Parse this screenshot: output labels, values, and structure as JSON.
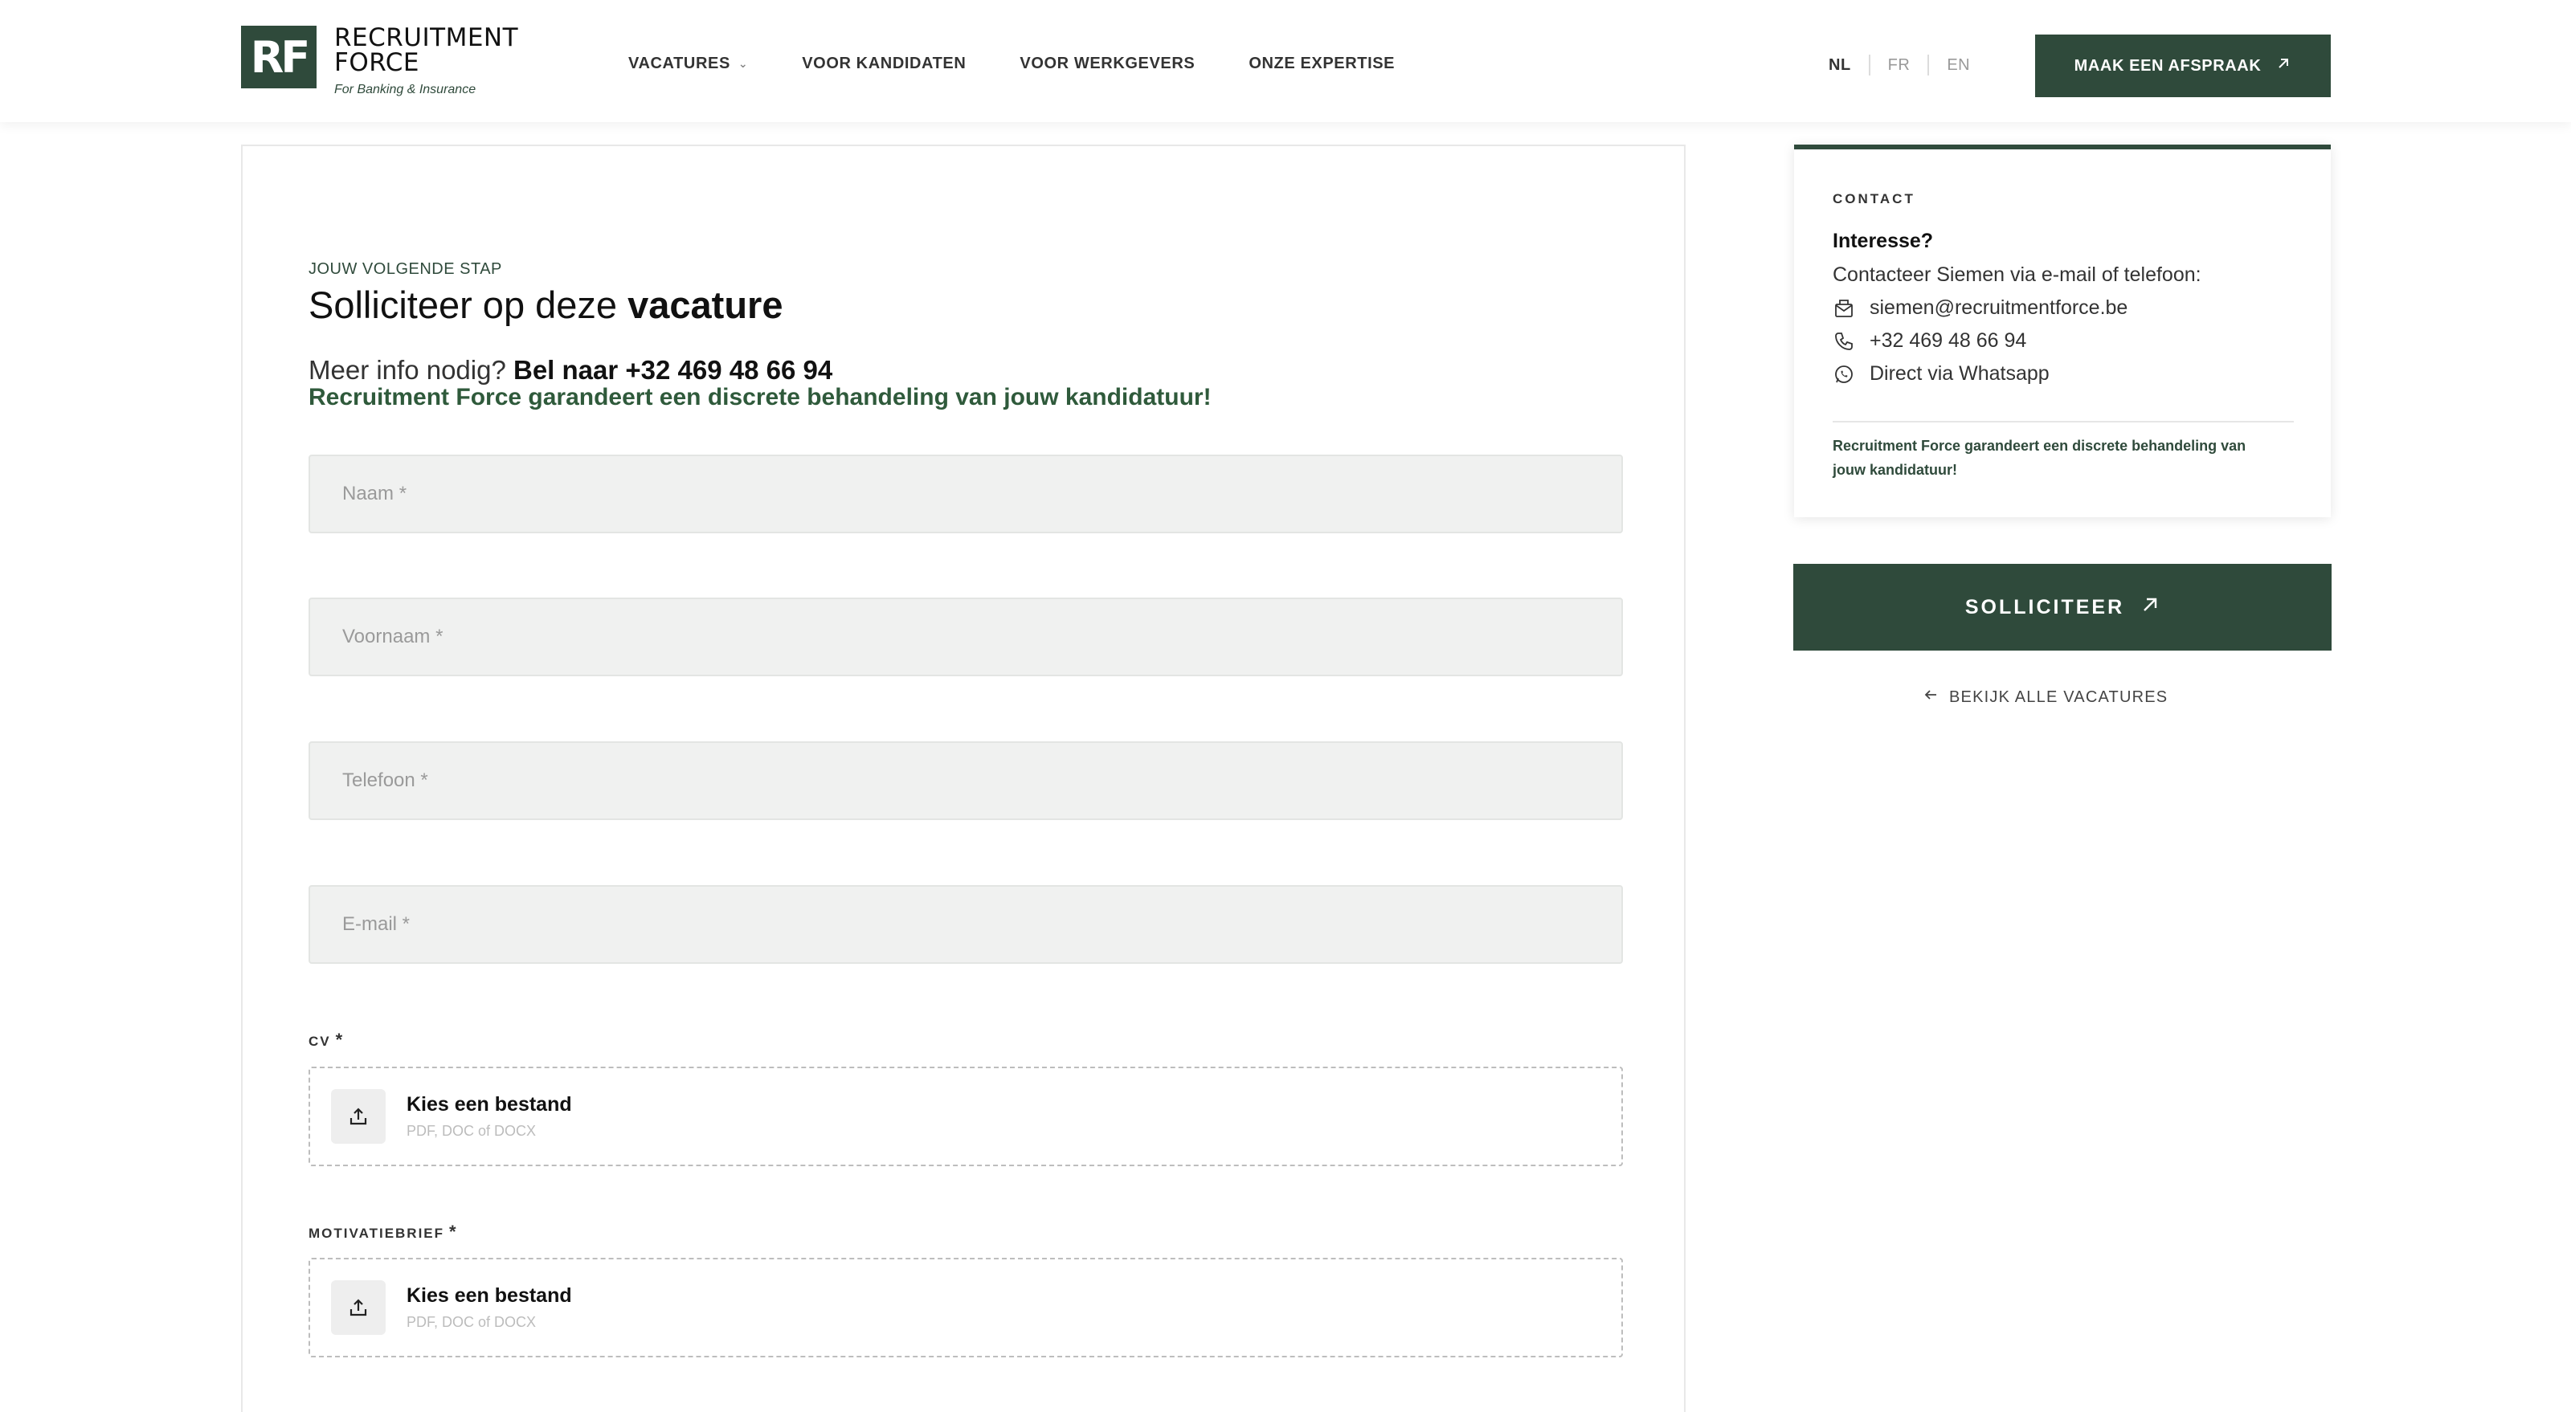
{
  "header": {
    "logo": {
      "mark": "RF",
      "line1": "RECRUITMENT",
      "line2": "FORCE",
      "tagline": "For Banking & Insurance"
    },
    "nav": [
      {
        "label": "VACATURES"
      },
      {
        "label": "VOOR KANDIDATEN"
      },
      {
        "label": "VOOR WERKGEVERS"
      },
      {
        "label": "ONZE EXPERTISE"
      }
    ],
    "languages": {
      "nl": "NL",
      "fr": "FR",
      "en": "EN",
      "active": "NL"
    },
    "cta_label": "MAAK EEN AFSPRAAK"
  },
  "form": {
    "eyebrow": "JOUW VOLGENDE STAP",
    "title_prefix": "Solliciteer op deze",
    "title_bold": "vacature",
    "info_prefix": "Meer info nodig?",
    "info_bold": "Bel naar +32 469 48 66 94",
    "guarantee": "Recruitment Force garandeert een discrete behandeling van jouw kandidatuur!",
    "fields": {
      "naam": "Naam *",
      "voornaam": "Voornaam *",
      "telefoon": "Telefoon *",
      "email": "E-mail *"
    },
    "cv": {
      "label": "CV",
      "required": "*",
      "button": "Kies een bestand",
      "hint": "PDF, DOC of DOCX"
    },
    "motivatie": {
      "label": "MOTIVATIEBRIEF",
      "required": "*",
      "button": "Kies een bestand",
      "hint": "PDF, DOC of DOCX"
    }
  },
  "contact": {
    "eyebrow": "CONTACT",
    "interest": "Interesse?",
    "line": "Contacteer Siemen via e-mail of telefoon:",
    "email": "siemen@recruitmentforce.be",
    "phone": "+32 469 48 66 94",
    "whatsapp": "Direct via Whatsapp",
    "note": "Recruitment Force garandeert een discrete behandeling van jouw kandidatuur!"
  },
  "apply_label": "SOLLICITEER",
  "back_label": "BEKIJK ALLE VACATURES",
  "colors": {
    "brand": "#2f4a3b",
    "accent_text": "#2f5a3b",
    "field_bg": "#f0f1f0"
  }
}
